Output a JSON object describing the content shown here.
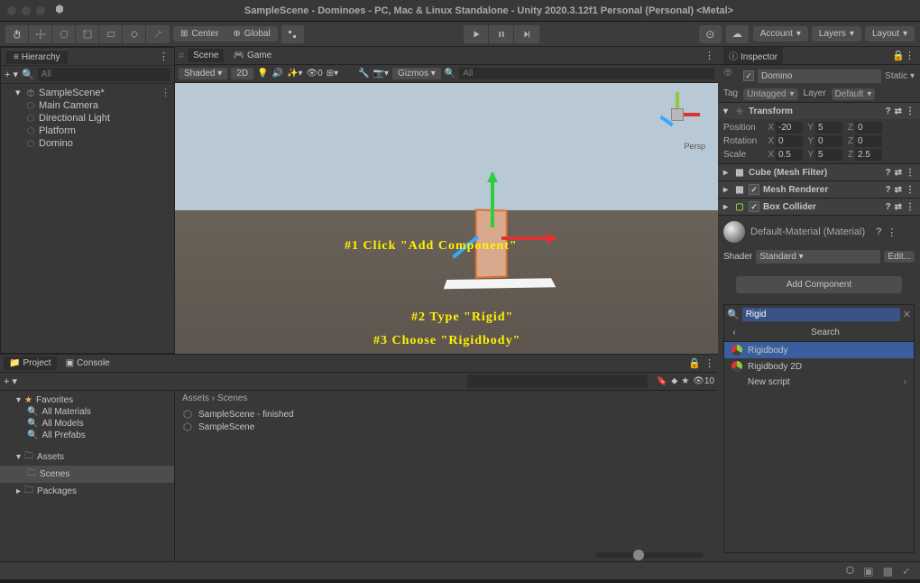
{
  "window": {
    "title": "SampleScene - Dominoes - PC, Mac & Linux Standalone - Unity 2020.3.12f1 Personal (Personal) <Metal>"
  },
  "toolbar": {
    "pivot": "Center",
    "space": "Global",
    "account": "Account",
    "layers": "Layers",
    "layout": "Layout"
  },
  "hierarchy": {
    "tab": "Hierarchy",
    "search_placeholder": "All",
    "scene": "SampleScene*",
    "items": [
      "Main Camera",
      "Directional Light",
      "Platform",
      "Domino"
    ]
  },
  "scene": {
    "tab_scene": "Scene",
    "tab_game": "Game",
    "shading": "Shaded",
    "mode2d": "2D",
    "gizmos": "Gizmos",
    "search_placeholder": "All",
    "persp": "Persp"
  },
  "annotations": {
    "step1": "#1 Click \"Add Component\"",
    "step2": "#2 Type \"Rigid\"",
    "step3": "#3 Choose \"Rigidbody\""
  },
  "inspector": {
    "tab": "Inspector",
    "object_name": "Domino",
    "static": "Static",
    "tag_label": "Tag",
    "tag": "Untagged",
    "layer_label": "Layer",
    "layer": "Default",
    "transform": {
      "name": "Transform",
      "pos_label": "Position",
      "rot_label": "Rotation",
      "scale_label": "Scale",
      "pos": {
        "x": "-20",
        "y": "5",
        "z": "0"
      },
      "rot": {
        "x": "0",
        "y": "0",
        "z": "0"
      },
      "scale": {
        "x": "0.5",
        "y": "5",
        "z": "2.5"
      }
    },
    "mesh_filter": "Cube (Mesh Filter)",
    "mesh_renderer": "Mesh Renderer",
    "box_collider": "Box Collider",
    "material": "Default-Material (Material)",
    "shader_label": "Shader",
    "shader": "Standard",
    "edit_btn": "Edit...",
    "add_component": "Add Component"
  },
  "component_search": {
    "query": "Rigid",
    "header": "Search",
    "items": [
      "Rigidbody",
      "Rigidbody 2D",
      "New script"
    ]
  },
  "project": {
    "tab_project": "Project",
    "tab_console": "Console",
    "search_placeholder": "",
    "hidden_count": "10",
    "favorites": "Favorites",
    "fav_items": [
      "All Materials",
      "All Models",
      "All Prefabs"
    ],
    "assets": "Assets",
    "scenes": "Scenes",
    "packages": "Packages",
    "breadcrumb1": "Assets",
    "breadcrumb2": "Scenes",
    "files": [
      "SampleScene - finished",
      "SampleScene"
    ]
  }
}
